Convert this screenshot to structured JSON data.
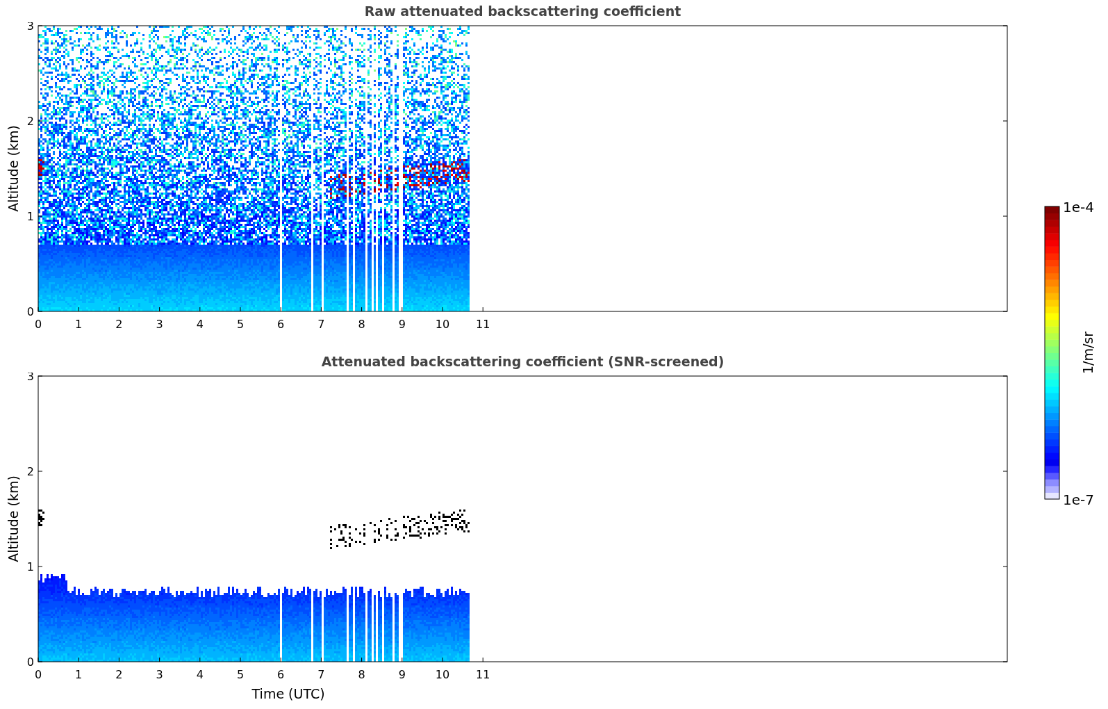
{
  "panels": [
    {
      "kind": "raw",
      "title": "Raw attenuated backscattering coefficient",
      "y_label": "Altitude (km)",
      "y_ticks": [
        "3",
        "2",
        "1",
        "0"
      ],
      "x_ticks": [
        "0",
        "1",
        "2",
        "3",
        "4",
        "5",
        "6",
        "7",
        "8",
        "9",
        "10",
        "11"
      ]
    },
    {
      "kind": "screened",
      "title": "Attenuated backscattering coefficient (SNR-screened)",
      "y_label": "Altitude (km)",
      "y_ticks": [
        "3",
        "2",
        "1",
        "0"
      ],
      "x_ticks": [
        "0",
        "1",
        "2",
        "3",
        "4",
        "5",
        "6",
        "7",
        "8",
        "9",
        "10",
        "11"
      ],
      "x_label": "Time (UTC)"
    }
  ],
  "colorbar": {
    "max_label": "1e-4",
    "min_label": "1e-7",
    "label": "1/m/sr"
  }
}
